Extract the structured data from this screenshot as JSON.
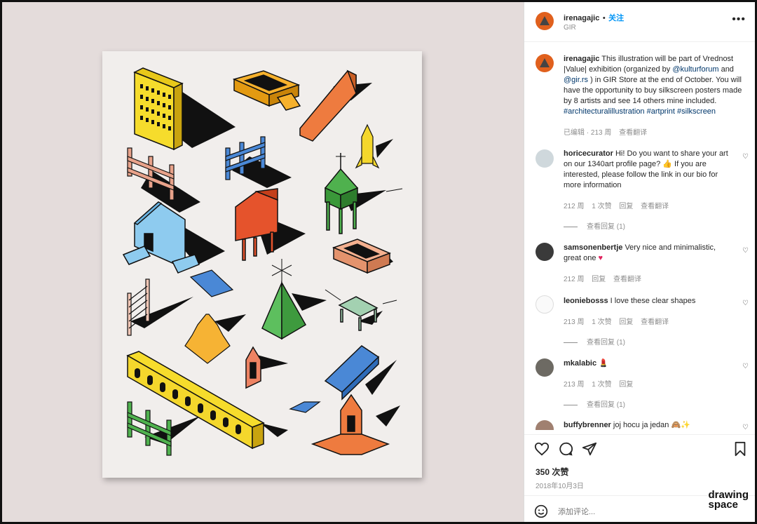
{
  "header": {
    "username": "irenagajic",
    "dot": "•",
    "follow": "关注",
    "location": "GIR",
    "more_icon": "more-icon"
  },
  "caption": {
    "username": "irenagajic",
    "t1": "This illustration will be part of Vrednost |Value| exhibition (organized by ",
    "m1": "@kulturforum",
    "t2": " and ",
    "m2": "@gir.rs",
    "t3": " ) in GIR Store at the end of October. You will have the opportunity to buy silkscreen posters made by 8 artists and see 14 others mine included. ",
    "tags": "#architecturalillustration #artprint #silkscreen",
    "edited": "已编辑 · 213 周",
    "translate": "查看翻译"
  },
  "comments": [
    {
      "username": "horicecurator",
      "text": "Hi! Do you want to share your art on our 1340art profile page? 👍 If you are interested, please follow the link in our bio for more information",
      "age": "212 周",
      "likes": "1 次赞",
      "reply": "回复",
      "translate": "查看翻译",
      "view_replies": "查看回复 (1)"
    },
    {
      "username": "samsonenbertje",
      "text": "Very nice and minimalistic, great one",
      "emoji": "♥",
      "age": "212 周",
      "reply": "回复",
      "translate": "查看翻译"
    },
    {
      "username": "leoniebosss",
      "text": "I love these clear shapes",
      "age": "213 周",
      "likes": "1 次赞",
      "reply": "回复",
      "translate": "查看翻译",
      "view_replies": "查看回复 (1)"
    },
    {
      "username": "mkalabic",
      "text": "",
      "emoji": "💄",
      "age": "213 周",
      "likes": "1 次赞",
      "reply": "回复",
      "view_replies": "查看回复 (1)"
    },
    {
      "username": "buffybrenner",
      "text": "joj hocu ja jedan 🙈✨"
    }
  ],
  "actions": {
    "likes": "350 次赞",
    "date": "2018年10月3日"
  },
  "add_comment": {
    "placeholder": "添加评论..."
  },
  "watermark": {
    "line1": "drawing",
    "line2": "space"
  },
  "colors": {
    "accent": "#0095f6",
    "poster_bg": "#f1eeec",
    "media_bg": "#e4dcdb"
  }
}
